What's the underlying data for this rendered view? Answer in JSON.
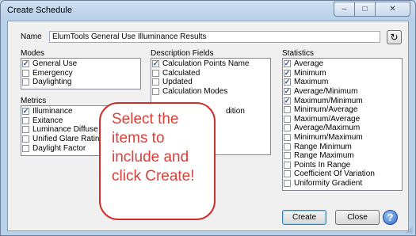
{
  "window": {
    "title": "Create Schedule"
  },
  "window_controls": {
    "minimize": "–",
    "maximize": "□",
    "close": "✕"
  },
  "name": {
    "label": "Name",
    "value": "ElumTools General Use Illuminance Results",
    "refresh_icon": "↻"
  },
  "modes": {
    "label": "Modes",
    "items": [
      {
        "label": "General Use",
        "checked": true
      },
      {
        "label": "Emergency",
        "checked": false
      },
      {
        "label": "Daylighting",
        "checked": false
      }
    ]
  },
  "metrics": {
    "label": "Metrics",
    "items": [
      {
        "label": "Illuminance",
        "checked": true
      },
      {
        "label": "Exitance",
        "checked": false
      },
      {
        "label": "Luminance Diffuse",
        "checked": false
      },
      {
        "label": "Unified Glare Rating",
        "checked": false
      },
      {
        "label": "Daylight Factor",
        "checked": false
      }
    ]
  },
  "description_fields": {
    "label": "Description Fields",
    "items": [
      {
        "label": "Calculation Points Name",
        "checked": true
      },
      {
        "label": "Calculated",
        "checked": false
      },
      {
        "label": "Updated",
        "checked": false
      },
      {
        "label": "Calculation Modes",
        "checked": false
      }
    ],
    "partial_text": "dition"
  },
  "statistics": {
    "label": "Statistics",
    "items": [
      {
        "label": "Average",
        "checked": true
      },
      {
        "label": "Minimum",
        "checked": true
      },
      {
        "label": "Maximum",
        "checked": true
      },
      {
        "label": "Average/Minimum",
        "checked": true
      },
      {
        "label": "Maximum/Minimum",
        "checked": true
      },
      {
        "label": "Minimum/Average",
        "checked": false
      },
      {
        "label": "Maximum/Average",
        "checked": false
      },
      {
        "label": "Average/Maximum",
        "checked": false
      },
      {
        "label": "Minimum/Maximum",
        "checked": false
      },
      {
        "label": "Range Minimum",
        "checked": false
      },
      {
        "label": "Range Maximum",
        "checked": false
      },
      {
        "label": "Points In Range",
        "checked": false
      },
      {
        "label": "Coefficient Of Variation",
        "checked": false
      },
      {
        "label": "Uniformity Gradient",
        "checked": false
      }
    ]
  },
  "buttons": {
    "create": "Create",
    "close": "Close",
    "help": "?"
  },
  "callout": {
    "text": "Select the items to include and click Create!",
    "color": "#d8403a"
  }
}
